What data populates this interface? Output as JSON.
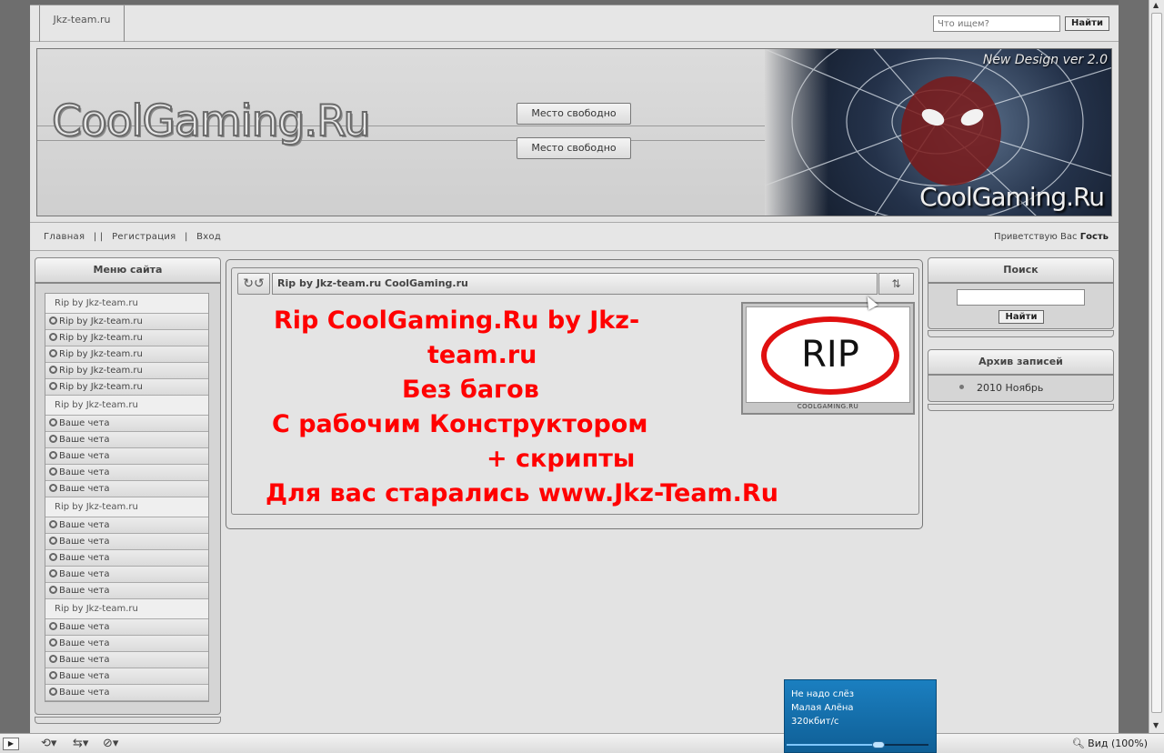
{
  "topbar": {
    "site_tab": "Jkz-team.ru",
    "search_placeholder": "Что ищем?",
    "search_button": "Найти"
  },
  "header": {
    "logo": "CoolGaming.Ru",
    "ad_slot_1": "Место свободно",
    "ad_slot_2": "Место свободно",
    "banner_version": "New Design ver 2.0",
    "banner_logo": "CoolGaming.Ru"
  },
  "nav": {
    "home": "Главная",
    "sep1": "| |",
    "register": "Регистрация",
    "sep2": "|",
    "login": "Вход",
    "greeting": "Приветствую Вас",
    "user": "Гость"
  },
  "menu": {
    "title": "Меню сайта",
    "groups": [
      {
        "head": "Rip by Jkz-team.ru",
        "items": [
          "Rip by Jkz-team.ru",
          "Rip by Jkz-team.ru",
          "Rip by Jkz-team.ru",
          "Rip by Jkz-team.ru",
          "Rip by Jkz-team.ru"
        ]
      },
      {
        "head": "Rip by Jkz-team.ru",
        "items": [
          "Ваше чета",
          "Ваше чета",
          "Ваше чета",
          "Ваше чета",
          "Ваше чета"
        ]
      },
      {
        "head": "Rip by Jkz-team.ru",
        "items": [
          "Ваше чета",
          "Ваше чета",
          "Ваше чета",
          "Ваше чета",
          "Ваше чета"
        ]
      },
      {
        "head": "Rip by Jkz-team.ru",
        "items": [
          "Ваше чета",
          "Ваше чета",
          "Ваше чета",
          "Ваше чета",
          "Ваше чета"
        ]
      }
    ]
  },
  "post": {
    "title": "Rip by Jkz-team.ru CoolGaming.ru",
    "lines": [
      "Rip CoolGaming.Ru by Jkz-",
      "team.ru",
      "Без багов",
      "С рабочим Конструктором",
      "+ скрипты",
      "Для вас старались www.Jkz-Team.Ru"
    ],
    "image_label": "RIP",
    "image_caption": "COOLGAMING.RU",
    "text_color": "#ff0000"
  },
  "search_block": {
    "title": "Поиск",
    "button": "Найти"
  },
  "archive_block": {
    "title": "Архив записей",
    "items": [
      "2010 Ноябрь"
    ]
  },
  "player": {
    "song": "Не надо слёз",
    "artist": "Малая Алёна",
    "bitrate": "320кбит/с"
  },
  "statusbar": {
    "zoom": "Вид (100%)"
  }
}
